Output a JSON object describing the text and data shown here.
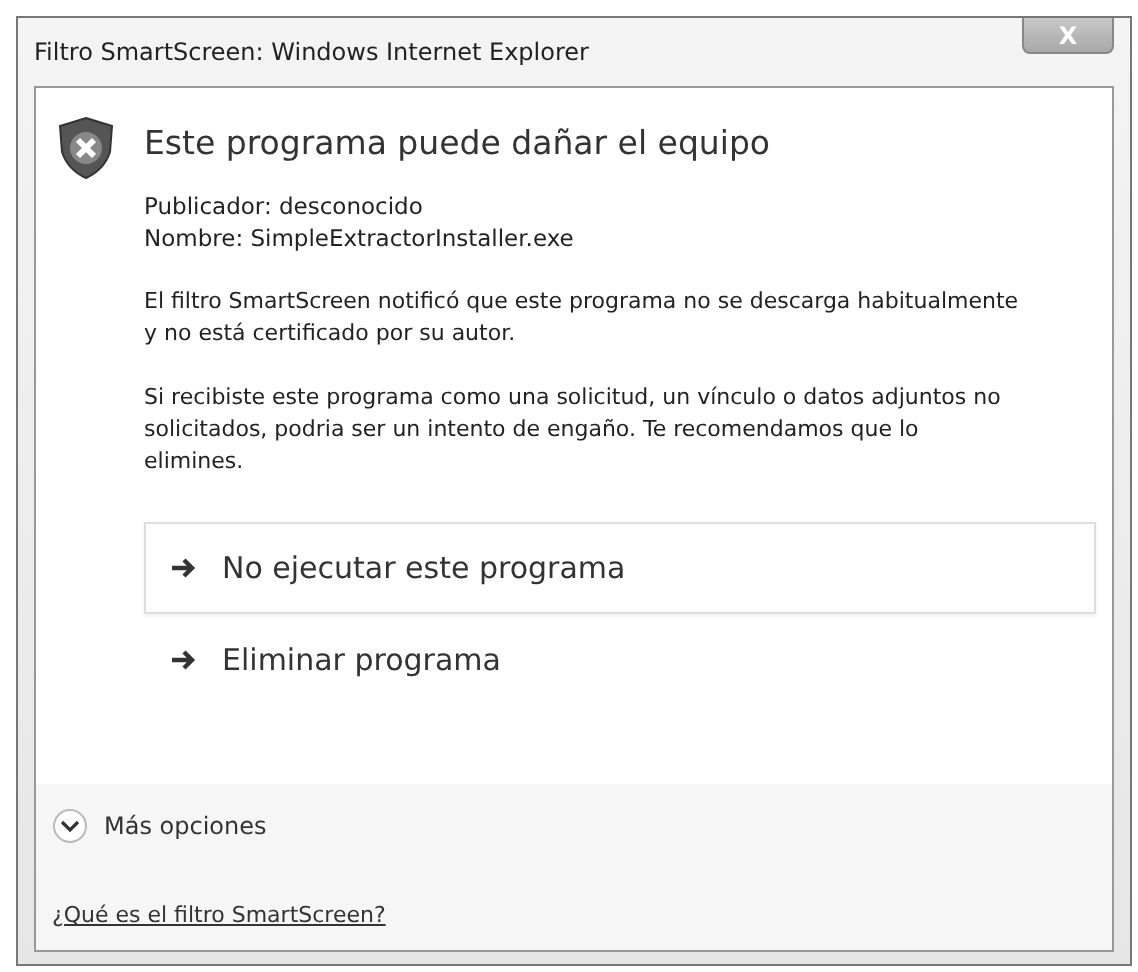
{
  "window": {
    "title": "Filtro SmartScreen: Windows Internet Explorer",
    "close": "X"
  },
  "heading": "Este programa puede dañar el equipo",
  "details": [
    "Publicador: desconocido",
    "Nombre: SimpleExtractorInstaller.exe"
  ],
  "paragraphs": [
    "El filtro SmartScreen notificó que este programa no se descarga habitualmente y no está certificado por su autor.",
    "Si recibiste este programa como una solicitud, un vínculo o datos adjuntos no solicitados, podria ser un intento de engaño. Te recomendamos que lo elimines."
  ],
  "options": [
    {
      "label": "No ejecutar este programa",
      "selected": true
    },
    {
      "label": "Eliminar programa",
      "selected": false
    }
  ],
  "more_options": {
    "label": "Más opciones",
    "expanded": false
  },
  "help_link": "¿Qué es el filtro SmartScreen?"
}
